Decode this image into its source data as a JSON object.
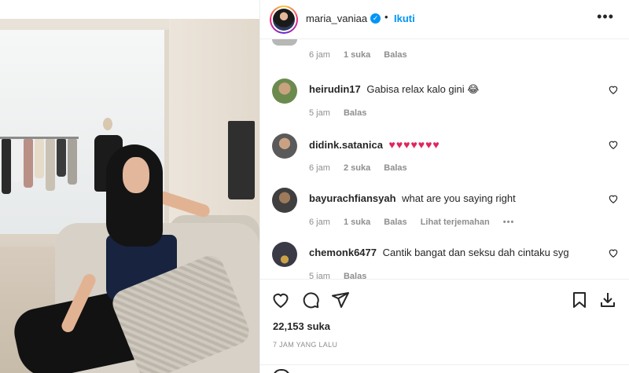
{
  "post": {
    "username": "maria_vaniaa",
    "follow_label": "Ikuti",
    "separator": "•"
  },
  "comments_top": {
    "time": "6 jam",
    "likes": "1 suka",
    "reply": "Balas"
  },
  "comments": [
    {
      "username": "heirudin17",
      "text": "Gabisa relax kalo gini 😂",
      "time": "5 jam",
      "likes": "",
      "reply": "Balas",
      "translate": ""
    },
    {
      "username": "didink.satanica",
      "text": "♥♥♥♥♥♥♥",
      "time": "6 jam",
      "likes": "2 suka",
      "reply": "Balas",
      "translate": ""
    },
    {
      "username": "bayurachfiansyah",
      "text": "what are you saying right",
      "time": "6 jam",
      "likes": "1 suka",
      "reply": "Balas",
      "translate": "Lihat terjemahan"
    },
    {
      "username": "chemonk6477",
      "text": "Cantik bangat dan seksu dah cintaku syg",
      "time": "5 jam",
      "likes": "",
      "reply": "Balas",
      "translate": ""
    }
  ],
  "actions": {
    "likes_count": "22,153 suka",
    "time_ago": "7 JAM YANG LALU"
  },
  "colors": {
    "accent": "#0095f6",
    "heart_red": "#e0245e",
    "muted": "#8e8e8e",
    "text": "#262626"
  }
}
